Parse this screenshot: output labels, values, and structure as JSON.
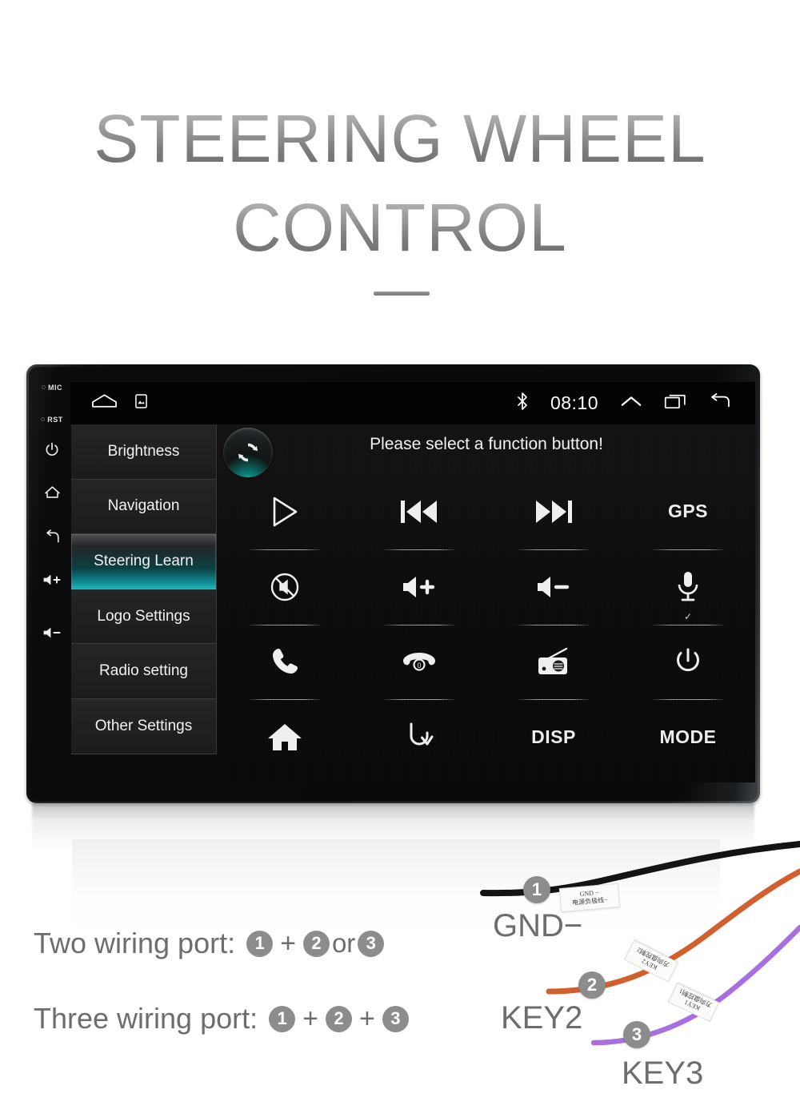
{
  "title": {
    "line1": "STEERING WHEEL",
    "line2": "CONTROL"
  },
  "device": {
    "bezel_buttons": [
      {
        "name": "mic",
        "label": "MIC",
        "type": "hole"
      },
      {
        "name": "reset",
        "label": "RST",
        "type": "hole"
      },
      {
        "name": "power",
        "label": "",
        "type": "icon"
      },
      {
        "name": "home",
        "label": "",
        "type": "icon"
      },
      {
        "name": "back",
        "label": "",
        "type": "icon"
      },
      {
        "name": "volume-up",
        "label": "",
        "type": "icon"
      },
      {
        "name": "volume-down",
        "label": "",
        "type": "icon"
      }
    ],
    "statusbar": {
      "clock": "08:10",
      "left_icons": [
        "home-icon",
        "screenshot-icon"
      ],
      "right_icons": [
        "bluetooth-icon",
        "chevron-up-icon",
        "recents-icon",
        "back-icon"
      ]
    },
    "menu": {
      "items": [
        {
          "label": "Brightness",
          "selected": false
        },
        {
          "label": "Navigation",
          "selected": false
        },
        {
          "label": "Steering Learn",
          "selected": true
        },
        {
          "label": "Logo Settings",
          "selected": false
        },
        {
          "label": "Radio setting",
          "selected": false
        },
        {
          "label": "Other Settings",
          "selected": false
        }
      ]
    },
    "panel": {
      "prompt": "Please select a function button!",
      "reset_icon": "refresh-icon",
      "buttons": [
        {
          "icon": "play-icon",
          "text": ""
        },
        {
          "icon": "previous-track-icon",
          "text": ""
        },
        {
          "icon": "next-track-icon",
          "text": ""
        },
        {
          "icon": "",
          "text": "GPS"
        },
        {
          "icon": "mute-icon",
          "text": ""
        },
        {
          "icon": "volume-up-icon",
          "text": ""
        },
        {
          "icon": "volume-down-icon",
          "text": ""
        },
        {
          "icon": "microphone-icon",
          "text": "",
          "checked": "✓"
        },
        {
          "icon": "phone-call-icon",
          "text": ""
        },
        {
          "icon": "phone-hangup-icon",
          "text": ""
        },
        {
          "icon": "radio-icon",
          "text": ""
        },
        {
          "icon": "power-icon",
          "text": ""
        },
        {
          "icon": "home-icon",
          "text": ""
        },
        {
          "icon": "back-icon",
          "text": ""
        },
        {
          "icon": "",
          "text": "DISP"
        },
        {
          "icon": "",
          "text": "MODE"
        }
      ]
    }
  },
  "wiring": {
    "two_port": {
      "label": "Two wiring port:",
      "a": "1",
      "plus": "+",
      "b": "2",
      "or": "or",
      "c": "3"
    },
    "three_port": {
      "label": "Three wiring port:",
      "a": "1",
      "plus1": "+",
      "b": "2",
      "plus2": "+",
      "c": "3"
    },
    "wires": [
      {
        "badge": "1",
        "name": "GND−",
        "color": "#151515",
        "tag_en": "GND −",
        "tag_cn": "电源负极线−"
      },
      {
        "badge": "2",
        "name": "KEY2",
        "color": "#d2602f",
        "tag_en": "KEY2",
        "tag_cn": "方向盘控制2"
      },
      {
        "badge": "3",
        "name": "KEY3",
        "color": "#a86fe0",
        "tag_en": "KEY1",
        "tag_cn": "方向盘控制1"
      }
    ]
  },
  "colors": {
    "accent_teal": "#14b5bb",
    "title_gray": "#8a8a8a",
    "badge_gray": "#8c8c8c",
    "text_gray": "#6d6d6d"
  }
}
